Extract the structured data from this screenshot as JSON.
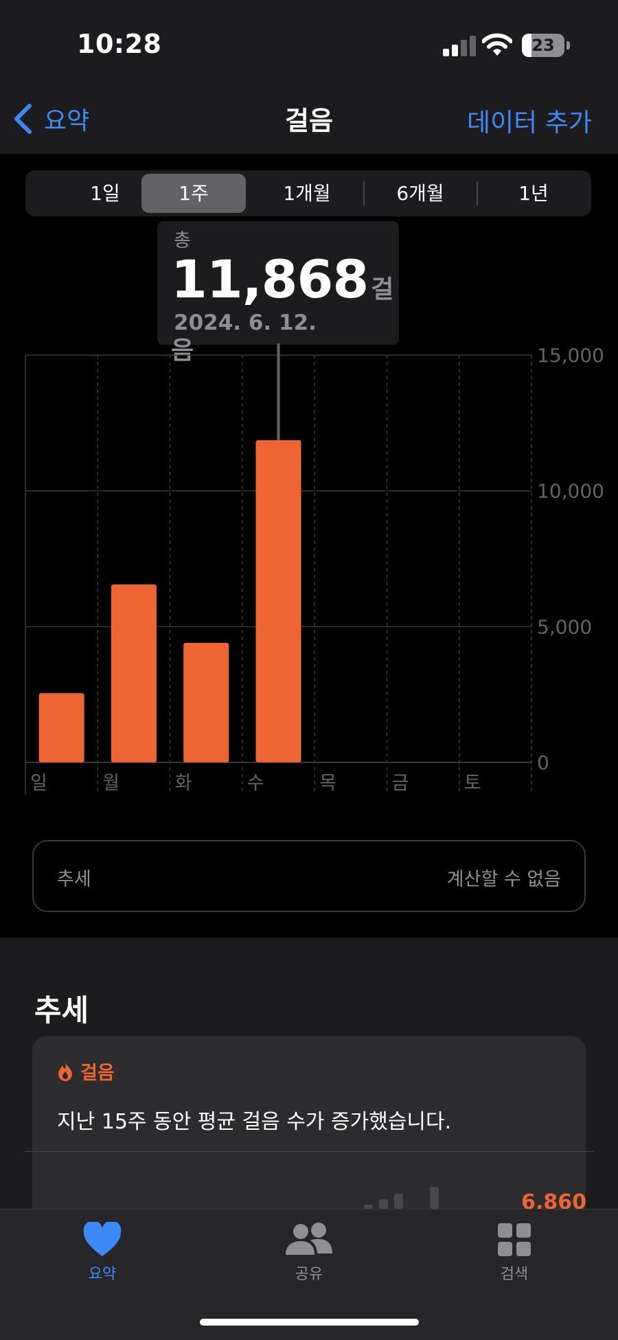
{
  "status_bar": {
    "time": "10:28",
    "battery": "23",
    "battery_level": 0.23
  },
  "nav": {
    "back_label": "요약",
    "title": "걸음",
    "add_data_label": "데이터 추가"
  },
  "segments": [
    {
      "label": "1일",
      "selected": false
    },
    {
      "label": "1주",
      "selected": true
    },
    {
      "label": "1개월",
      "selected": false
    },
    {
      "label": "6개월",
      "selected": false
    },
    {
      "label": "1년",
      "selected": false
    }
  ],
  "tooltip": {
    "label": "총",
    "value": "11,868",
    "unit": "걸음",
    "date": "2024. 6. 12."
  },
  "chart_data": {
    "type": "bar",
    "categories": [
      "일",
      "월",
      "화",
      "수",
      "목",
      "금",
      "토"
    ],
    "values": [
      2550,
      6550,
      4400,
      11868,
      null,
      null,
      null
    ],
    "y_ticks": [
      "15,000",
      "10,000",
      "5,000",
      "0"
    ],
    "ylim": [
      0,
      15000
    ],
    "selected_index": 3,
    "bar_color": "#ee6534",
    "grid": true
  },
  "trend_summary": {
    "label": "추세",
    "value": "계산할 수 없음"
  },
  "trends_section": {
    "title": "추세",
    "card": {
      "category": "걸음",
      "text": "지난 15주 동안 평균 걸음 수가 증가했습니다.",
      "value": "6,860"
    }
  },
  "tabs": [
    {
      "label": "요약",
      "icon": "heart-icon",
      "active": true
    },
    {
      "label": "공유",
      "icon": "people-icon",
      "active": false
    },
    {
      "label": "검색",
      "icon": "grid-icon",
      "active": false
    }
  ],
  "colors": {
    "accent": "#3d8af7",
    "steps": "#ee6534",
    "background": "#000000"
  }
}
